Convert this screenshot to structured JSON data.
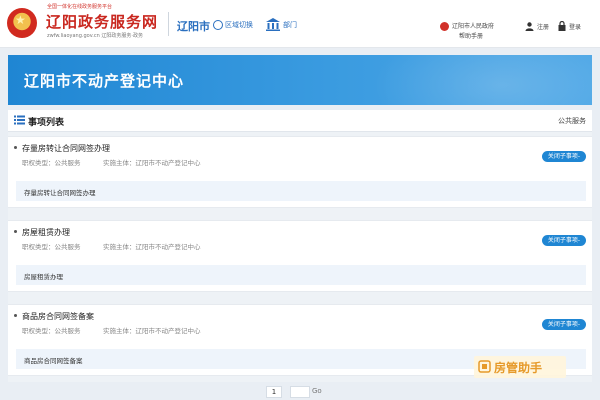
{
  "header": {
    "brand_tagline": "全国一体化在线政务服务平台",
    "brand_title": "辽阳政务服务网",
    "brand_domain": "zwfw.liaoyang.gov.cn",
    "brand_sub": "辽阳政务服务·政务",
    "city": "辽阳市",
    "region_switch": "区域切换",
    "department": "部门",
    "gov_link": "辽阳市人民政府",
    "help_link": "帮助手册",
    "register": "注册",
    "login": "登录"
  },
  "banner": {
    "title": "辽阳市不动产登记中心"
  },
  "section": {
    "title": "事项列表",
    "right_label": "公共服务"
  },
  "items": [
    {
      "title": "存量房转让合同网签办理",
      "authority": "职权类型：公共服务",
      "org": "实施主体：辽阳市不动产登记中心",
      "sub": "存量房转让合同网签办理",
      "button": "关闭子事项-"
    },
    {
      "title": "房屋租赁办理",
      "authority": "职权类型：公共服务",
      "org": "实施主体：辽阳市不动产登记中心",
      "sub": "房屋租赁办理",
      "button": "关闭子事项-"
    },
    {
      "title": "商品房合同网签备案",
      "authority": "职权类型：公共服务",
      "org": "实施主体：辽阳市不动产登记中心",
      "sub": "商品房合同网签备案",
      "button": "关闭子事项-"
    }
  ],
  "pager": {
    "current": "1",
    "go": "Go"
  },
  "watermark": {
    "text": "房管助手"
  },
  "colors": {
    "accent": "#1f86d3",
    "brand": "#c9271f"
  }
}
